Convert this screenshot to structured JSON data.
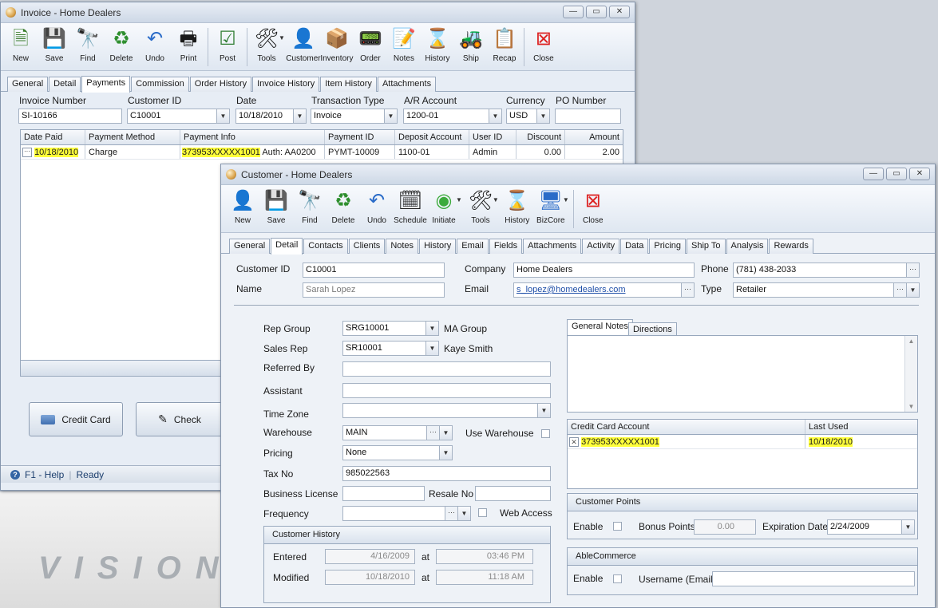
{
  "invoice": {
    "title": "Invoice - Home Dealers",
    "toolbar": [
      "New",
      "Save",
      "Find",
      "Delete",
      "Undo",
      "Print",
      "Post",
      "Tools",
      "Customer",
      "Inventory",
      "Order",
      "Notes",
      "History",
      "Ship",
      "Recap",
      "Close"
    ],
    "tabs": [
      "General",
      "Detail",
      "Payments",
      "Commission",
      "Order History",
      "Invoice History",
      "Item History",
      "Attachments"
    ],
    "active_tab": "Payments",
    "fields": {
      "invoice_number_label": "Invoice Number",
      "invoice_number": "SI-10166",
      "customer_id_label": "Customer ID",
      "customer_id": "C10001",
      "date_label": "Date",
      "date": "10/18/2010",
      "transaction_type_label": "Transaction Type",
      "transaction_type": "Invoice",
      "ar_account_label": "A/R Account",
      "ar_account": "1200-01",
      "currency_label": "Currency",
      "currency": "USD",
      "po_number_label": "PO Number",
      "po_number": ""
    },
    "payments_grid": {
      "columns": [
        "Date Paid",
        "Payment Method",
        "Payment Info",
        "Payment ID",
        "Deposit Account",
        "User ID",
        "Discount",
        "Amount"
      ],
      "rows": [
        {
          "date_paid": "10/18/2010",
          "method": "Charge",
          "info_card": "373953XXXXX1001",
          "info_auth": "Auth: AA0200",
          "payment_id": "PYMT-10009",
          "deposit_account": "1100-01",
          "user_id": "Admin",
          "discount": "0.00",
          "amount": "2.00"
        }
      ]
    },
    "buttons": {
      "credit_card": "Credit Card",
      "check": "Check"
    },
    "status": {
      "help": "F1 - Help",
      "state": "Ready"
    }
  },
  "background_logo": "VISION",
  "customer": {
    "title": "Customer - Home Dealers",
    "toolbar": [
      "New",
      "Save",
      "Find",
      "Delete",
      "Undo",
      "Schedule",
      "Initiate",
      "Tools",
      "History",
      "BizCore",
      "Close"
    ],
    "tabs": [
      "General",
      "Detail",
      "Contacts",
      "Clients",
      "Notes",
      "History",
      "Email",
      "Fields",
      "Attachments",
      "Activity",
      "Data",
      "Pricing",
      "Ship To",
      "Analysis",
      "Rewards"
    ],
    "active_tab": "Detail",
    "header": {
      "customer_id_label": "Customer ID",
      "customer_id": "C10001",
      "company_label": "Company",
      "company": "Home Dealers",
      "phone_label": "Phone",
      "phone": "(781) 438-2033",
      "name_label": "Name",
      "name": "Sarah Lopez",
      "email_label": "Email",
      "email": "s_lopez@homedealers.com",
      "type_label": "Type",
      "type": "Retailer"
    },
    "detail": {
      "rep_group_label": "Rep Group",
      "rep_group": "SRG10001",
      "rep_group_name": "MA Group",
      "sales_rep_label": "Sales Rep",
      "sales_rep": "SR10001",
      "sales_rep_name": "Kaye Smith",
      "referred_by_label": "Referred By",
      "referred_by": "",
      "assistant_label": "Assistant",
      "assistant": "",
      "time_zone_label": "Time Zone",
      "time_zone": "",
      "warehouse_label": "Warehouse",
      "warehouse": "MAIN",
      "use_warehouse_label": "Use Warehouse",
      "pricing_label": "Pricing",
      "pricing": "None",
      "tax_no_label": "Tax No",
      "tax_no": "985022563",
      "business_license_label": "Business License",
      "business_license": "",
      "resale_no_label": "Resale No",
      "resale_no": "",
      "frequency_label": "Frequency",
      "frequency": "",
      "web_access_label": "Web Access"
    },
    "history": {
      "title": "Customer History",
      "entered_label": "Entered",
      "entered_date": "4/16/2009",
      "at_label": "at",
      "entered_time": "03:46 PM",
      "modified_label": "Modified",
      "modified_date": "10/18/2010",
      "modified_time": "11:18 AM"
    },
    "notes_tabs": [
      "General Notes",
      "Directions"
    ],
    "cc_grid": {
      "columns": [
        "Credit Card Account",
        "Last Used"
      ],
      "rows": [
        {
          "account": "373953XXXXX1001",
          "last_used": "10/18/2010"
        }
      ]
    },
    "points": {
      "title": "Customer Points",
      "enable_label": "Enable",
      "bonus_label": "Bonus Points",
      "bonus": "0.00",
      "expiration_label": "Expiration Date",
      "expiration": "2/24/2009"
    },
    "able": {
      "title": "AbleCommerce",
      "enable_label": "Enable",
      "username_label": "Username (Email)",
      "username": ""
    }
  }
}
